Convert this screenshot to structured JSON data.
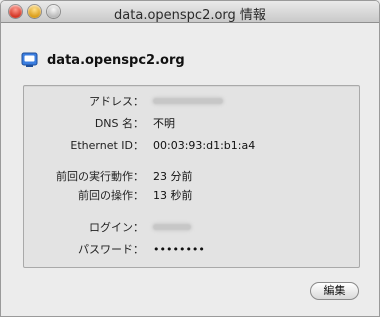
{
  "window": {
    "title": "data.openspc2.org 情報"
  },
  "header": {
    "host": "data.openspc2.org",
    "icon": "server-icon"
  },
  "info": {
    "address_label": "アドレス：",
    "dns_label": "DNS 名：",
    "dns_value": "不明",
    "ethernet_label": "Ethernet ID：",
    "ethernet_value": "00:03:93:d1:b1:a4",
    "last_run_label": "前回の実行動作：",
    "last_run_value": "23 分前",
    "last_op_label": "前回の操作：",
    "last_op_value": "13 秒前",
    "login_label": "ログイン：",
    "password_label": "パスワード：",
    "password_value": "••••••••"
  },
  "buttons": {
    "edit_label": "編集"
  }
}
